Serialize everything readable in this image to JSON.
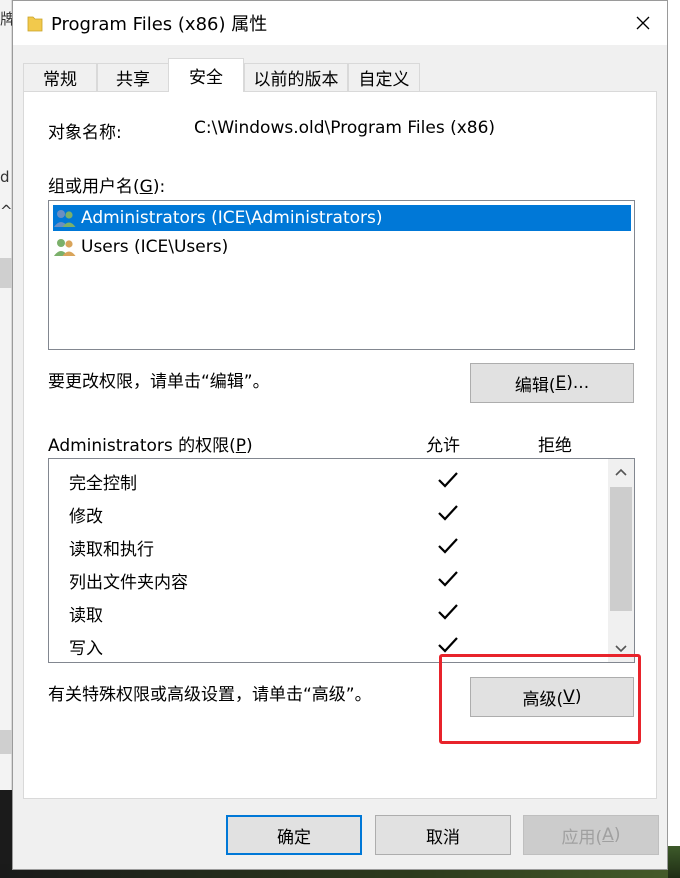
{
  "window": {
    "title": "Program Files (x86) 属性",
    "close_label": "✕"
  },
  "tabs": [
    {
      "label": "常规",
      "active": false
    },
    {
      "label": "共享",
      "active": false
    },
    {
      "label": "安全",
      "active": true
    },
    {
      "label": "以前的版本",
      "active": false
    },
    {
      "label": "自定义",
      "active": false
    }
  ],
  "security": {
    "object_label": "对象名称:",
    "object_value": "C:\\Windows.old\\Program Files (x86)",
    "groups_label": "组或用户名(",
    "groups_accel": "G",
    "groups_label_end": "):",
    "users": [
      {
        "name": "Administrators (ICE\\Administrators)",
        "selected": true
      },
      {
        "name": "Users (ICE\\Users)",
        "selected": false
      }
    ],
    "edit_hint": "要更改权限，请单击“编辑”。",
    "edit_button": {
      "pre": "编辑(",
      "accel": "E",
      "post": ")..."
    },
    "perm_label": {
      "pre": "Administrators 的权限(",
      "accel": "P",
      "post": ")"
    },
    "allow_header": "允许",
    "deny_header": "拒绝",
    "permissions": [
      {
        "name": "完全控制",
        "allow": true,
        "deny": false
      },
      {
        "name": "修改",
        "allow": true,
        "deny": false
      },
      {
        "name": "读取和执行",
        "allow": true,
        "deny": false
      },
      {
        "name": "列出文件夹内容",
        "allow": true,
        "deny": false
      },
      {
        "name": "读取",
        "allow": true,
        "deny": false
      },
      {
        "name": "写入",
        "allow": true,
        "deny": false
      }
    ],
    "advanced_hint": "有关特殊权限或高级设置，请单击“高级”。",
    "advanced_button": {
      "pre": "高级(",
      "accel": "V",
      "post": ")"
    }
  },
  "footer": {
    "ok": "确定",
    "cancel": "取消",
    "apply": {
      "pre": "应用(",
      "accel": "A",
      "post": ")"
    }
  },
  "background": {
    "left_glyph_1": "d",
    "left_glyph_2": "^",
    "left_glyph_3": "牌"
  },
  "colors": {
    "selection": "#0078d7",
    "highlight": "#e8232b",
    "folder": "#f2c94c"
  },
  "icons": {
    "folder": "folder-icon",
    "users": "users-group-icon",
    "check": "checkmark-icon",
    "close": "close-icon"
  }
}
